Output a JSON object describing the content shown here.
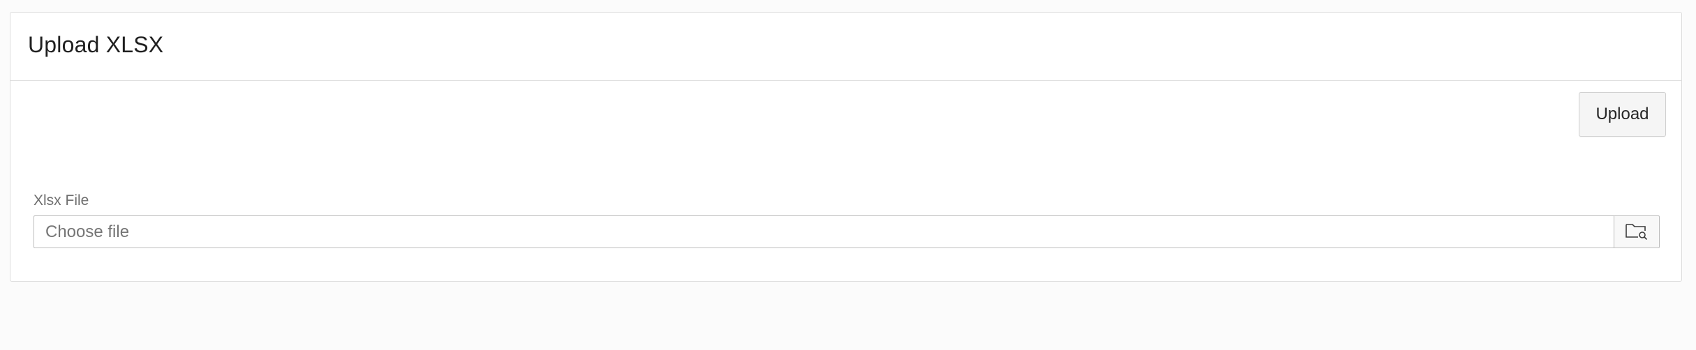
{
  "region": {
    "title": "Upload XLSX"
  },
  "actions": {
    "upload_label": "Upload"
  },
  "xlsx_file": {
    "label": "Xlsx File",
    "placeholder": "Choose file",
    "value": ""
  },
  "icons": {
    "browse": "folder-search-icon"
  },
  "colors": {
    "background": "#fbfbfb",
    "panel": "#ffffff",
    "border": "#dcdcdc",
    "button": "#f5f5f5"
  }
}
